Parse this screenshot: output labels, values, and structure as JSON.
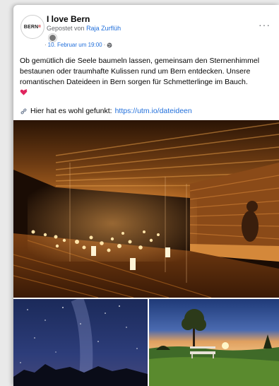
{
  "post": {
    "avatar_text": "BERN",
    "avatar_sup": "®",
    "page_name": "I love Bern",
    "posted_by_prefix": "Gepostet von",
    "posted_by_author": "Raja Zurflüh",
    "date": "10. Februar um 19:00",
    "date_separator": "·",
    "date_prefix": "·",
    "more_label": "···",
    "text": "Ob gemütlich die Seele baumeln lassen, gemeinsam den Sternenhimmel bestaunen oder traumhafte Kulissen rund um Bern entdecken. Unsere romantischen Dateideen in Bern sorgen für Schmetterlinge im Bauch.",
    "link_text": "Hier hat es wohl gefunkt:",
    "link_url": "https://utm.io/dateideen"
  },
  "icons": {
    "globe": "globe-icon",
    "heart": "heart-icon",
    "link": "link-icon",
    "more": "more-options-icon"
  },
  "colors": {
    "link": "#216fdb",
    "text": "#050505",
    "meta": "#65676b",
    "heart": "#e0245e"
  }
}
